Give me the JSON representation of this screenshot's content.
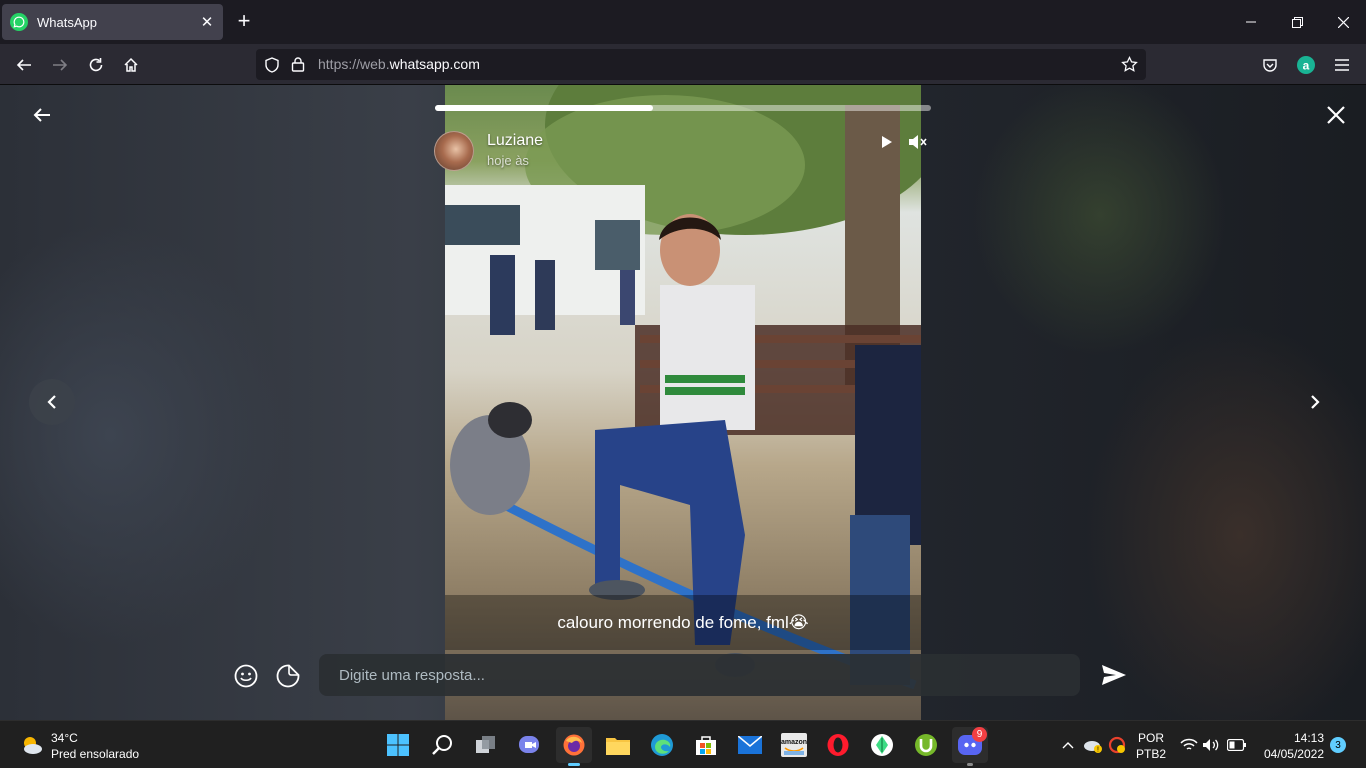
{
  "browser": {
    "tab_title": "WhatsApp",
    "tab_close": "✕",
    "new_tab": "+",
    "url_prefix": "https://web.",
    "url_domain": "whatsapp.com"
  },
  "status": {
    "sender": "Luziane",
    "time": "hoje às",
    "progress": 0.44,
    "caption": "calouro morrendo de fome, fml😭"
  },
  "reply": {
    "placeholder": "Digite uma resposta..."
  },
  "taskbar": {
    "weather_temp": "34°C",
    "weather_desc": "Pred ensolarado",
    "discord_badge": "9",
    "lang_top": "POR",
    "lang_bottom": "PTB2",
    "clock_time": "14:13",
    "clock_date": "04/05/2022",
    "notif_count": "3"
  },
  "colors": {
    "whatsapp_green": "#25d366",
    "taskbar_bg": "#202020",
    "browser_bg": "#1c1b22"
  }
}
